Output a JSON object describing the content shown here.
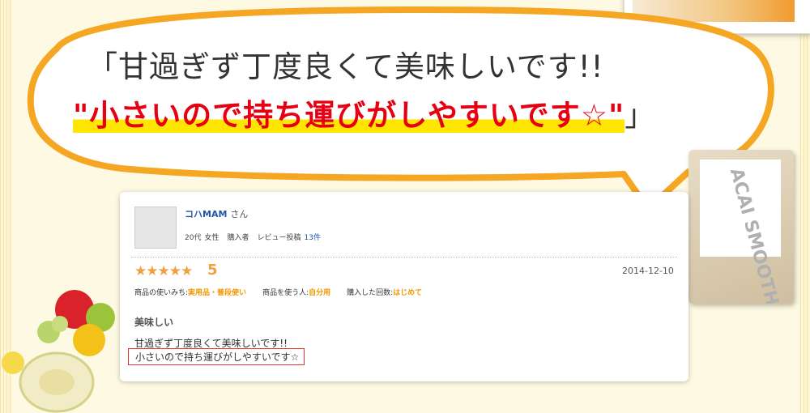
{
  "headline": {
    "line1": "「甘過ぎず丁度良くて美味しいです!!",
    "line2_quote_open": "\"",
    "line2_main": "小さいので持ち運びがしやすいです☆",
    "line2_quote_close": "\"",
    "line2_bracket": "」"
  },
  "review": {
    "user_name": "コハMAM",
    "user_suffix": "さん",
    "age": "20代",
    "gender": "女性",
    "buyer": "購入者",
    "posts_label": "レビュー投稿",
    "posts_count": "13件",
    "stars": "★★★★★",
    "score": "5",
    "date": "2014-12-10",
    "usage_label": "商品の使いみち:",
    "usage_value": "実用品・普段使い",
    "user_label": "商品を使う人:",
    "user_value": "自分用",
    "purchase_label": "購入した回数:",
    "purchase_value": "はじめて",
    "title": "美味しい",
    "body_line1": "甘過ぎず丁度良くて美味しいです!!",
    "body_line2": "小さいので持ち運びがしやすいです☆"
  },
  "product": {
    "name_text": "ACAI SMOOTHIE PLUS+"
  },
  "colors": {
    "accent_red": "#e60012",
    "highlight_yellow": "#ffe600",
    "bubble_orange": "#f5a623",
    "rating_orange": "#f0a040",
    "link_blue": "#2255aa"
  }
}
